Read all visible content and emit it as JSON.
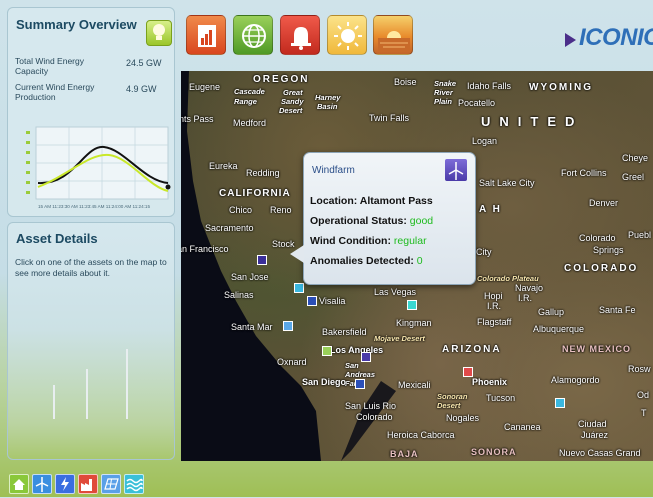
{
  "summary": {
    "title": "Summary Overview",
    "stats": [
      {
        "label": "Total Wind Energy Capacity",
        "value": "24.5 GW"
      },
      {
        "label": "Current Wind Energy Production",
        "value": "4.9 GW"
      }
    ],
    "chart_xlabels": "15 AM 11:23:30 AM 11:23:45 AM 11:24:00 AM 11:24:15"
  },
  "assets": {
    "title": "Asset Details",
    "text": "Click on one of the assets on the map to see more details about it."
  },
  "toolbar": {
    "buttons": [
      {
        "icon": "bar-chart-icon",
        "color": "#e8582a"
      },
      {
        "icon": "globe-icon",
        "color": "#6fb839"
      },
      {
        "icon": "alarm-bell-icon",
        "color": "#d83a2c"
      },
      {
        "icon": "sun-icon",
        "color": "#f2c24a"
      },
      {
        "icon": "sunset-icon",
        "color": "#e89a3c"
      }
    ]
  },
  "logo": {
    "text": "ICONICS",
    "color": "#2e6fb8"
  },
  "popup": {
    "title": "Windfarm",
    "location_label": "Location:",
    "location_value": "Altamont Pass",
    "status_label": "Operational Status:",
    "status_value": "good",
    "wind_label": "Wind Condition:",
    "wind_value": "regular",
    "anomalies_label": "Anomalies Detected:",
    "anomalies_value": "0"
  },
  "map_labels": {
    "oregon": "OREGON",
    "boise": "Boise",
    "snake": "Snake",
    "river": "River",
    "plain": "Plain",
    "idaho_falls": "Idaho Falls",
    "wyoming": "WYOMING",
    "pocatello": "Pocatello",
    "eugene": "Eugene",
    "cascade": "Cascade",
    "range": "Range",
    "great": "Great",
    "sandy": "Sandy",
    "desert": "Desert",
    "harney": "Harney",
    "basin": "Basin",
    "nts_pass": "nts Pass",
    "medford": "Medford",
    "twin_falls": "Twin Falls",
    "united": "UNITED",
    "logan": "Logan",
    "eureka": "Eureka",
    "redding": "Redding",
    "salt_lake": "Salt Lake City",
    "fort_collins": "Fort Collins",
    "cheye": "Cheye",
    "greel": "Greel",
    "california": "CALIFORNIA",
    "chico": "Chico",
    "reno": "Reno",
    "denver": "Denver",
    "sacramento": "Sacramento",
    "ah": "A H",
    "colorado_sp": "Colorado",
    "springs": "Springs",
    "pueb": "Puebl",
    "san_francisco": "an Francisco",
    "stock": "Stock",
    "city": "City",
    "colorado_state": "COLORADO",
    "san_jose": "San Jose",
    "colorado_plateau": "Colorado Plateau",
    "navajo": "Navajo",
    "hopi": "Hopi",
    "ir1": "I.R.",
    "ir2": "I.R.",
    "salinas": "Salinas",
    "visalia": "Visalia",
    "las_vegas": "Las Vegas",
    "gallup": "Gallup",
    "santa_fe": "Santa Fe",
    "santa_maria": "Santa Mar",
    "kingman": "Kingman",
    "flagstaff": "Flagstaff",
    "albuquerque": "Albuquerque",
    "bakersfield": "Bakersfield",
    "mojave": "Mojave Desert",
    "los_angeles": "Los Angeles",
    "arizona": "ARIZONA",
    "new_mexico": "NEW MEXICO",
    "oxnard": "Oxnard",
    "san_andreas": "San Andreas Fault",
    "rosw": "Rosw",
    "san_diego": "San Diego",
    "mexicali": "Mexicali",
    "phoenix": "Phoenix",
    "alamogordo": "Alamogordo",
    "sonoran": "Sonoran Desert",
    "tucson": "Tucson",
    "san_luis": "San Luis Rio",
    "colorado_city": "Colorado",
    "nogales": "Nogales",
    "cananea": "Cananea",
    "ciudad": "Ciudad",
    "juarez": "Juárez",
    "heroica": "Heroica Caborca",
    "baja": "BAJA",
    "sonora": "SONORA",
    "nuevo": "Nuevo Casas Grand",
    "tu": "T",
    "od": "Od"
  },
  "bottom_bar": [
    {
      "icon": "home-icon"
    },
    {
      "icon": "wind-turbine-icon"
    },
    {
      "icon": "lightning-icon"
    },
    {
      "icon": "factory-icon"
    },
    {
      "icon": "solar-panel-icon"
    },
    {
      "icon": "water-waves-icon"
    }
  ]
}
